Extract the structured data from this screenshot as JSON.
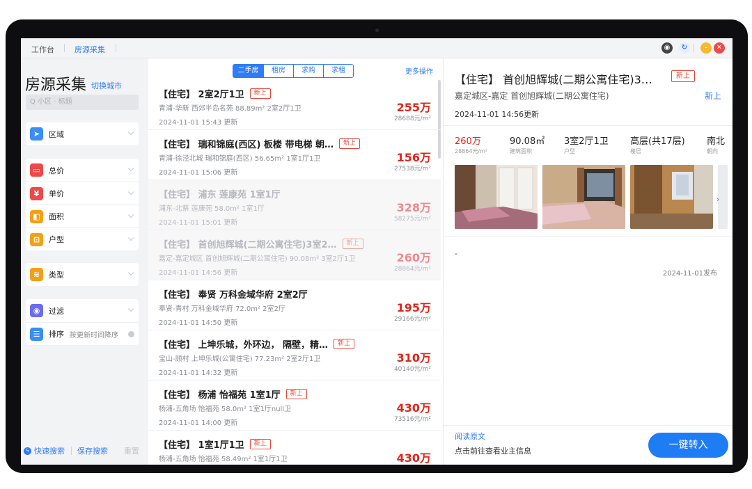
{
  "topbar": {
    "tabs": [
      {
        "label": "工作台"
      },
      {
        "label": "房源采集"
      }
    ],
    "icons": [
      "globe-icon",
      "refresh-icon",
      "minimize-icon",
      "close-icon"
    ]
  },
  "sidebar": {
    "title": "房源采集",
    "switch_city": "切换城市",
    "search_placeholder": "Q 小区 · 标题",
    "groups": [
      {
        "items": [
          {
            "label": "区域",
            "icon": "location-arrow-icon",
            "color": "#3a8ef6"
          }
        ]
      },
      {
        "items": [
          {
            "label": "总价",
            "icon": "wallet-icon",
            "color": "#f04848"
          },
          {
            "label": "单价",
            "icon": "yen-icon",
            "color": "#f04848"
          },
          {
            "label": "面积",
            "icon": "area-icon",
            "color": "#f5a014"
          },
          {
            "label": "户型",
            "icon": "floorplan-icon",
            "color": "#f5a014"
          }
        ]
      },
      {
        "items": [
          {
            "label": "类型",
            "icon": "layers-icon",
            "color": "#f5a014"
          }
        ]
      },
      {
        "items": [
          {
            "label": "过滤",
            "icon": "filter-icon",
            "color": "#6b6cf0"
          },
          {
            "label": "排序",
            "icon": "list-icon",
            "color": "#3a8ef6",
            "value": "按更新时间降序"
          }
        ]
      }
    ],
    "quick_search": "快速搜索",
    "save_search": "保存搜索",
    "reset": "重置"
  },
  "list": {
    "filter_tabs": [
      "二手房",
      "租房",
      "求购",
      "求租"
    ],
    "more_actions": "更多操作",
    "items": [
      {
        "title": "【住宅】 2室2厅1卫",
        "badge": "新上",
        "sub": "青浦-华新    西郊半岛名苑    88.89m²    2室2厅1卫",
        "time": "2024-11-01 15:43 更新",
        "price": "255万",
        "unit": "28688元/m²",
        "dim": false
      },
      {
        "title": "【住宅】 瑞和锦庭(西区) 板楼 带电梯 朝…",
        "badge": "新上",
        "sub": "青浦-徐泾北城    瑞和锦庭(西区)    56.65m²    1室1厅1卫",
        "time": "2024-11-01 15:06 更新",
        "price": "156万",
        "unit": "27538元/m²",
        "dim": false
      },
      {
        "title": "【住宅】 浦东 莲康苑 1室1厅",
        "badge": "",
        "sub": "浦东-北蔡    莲康苑    58.0m²    1室1厅",
        "time": "2024-11-01 15:01 更新",
        "price": "328万",
        "unit": "58275元/m²",
        "dim": true
      },
      {
        "title": "【住宅】 首创旭辉城(二期公寓住宅)3室2…",
        "badge": "新上",
        "sub": "嘉定-嘉定城区    首创旭辉城(二期公寓住宅)    90.08m²    3室2厅1卫",
        "time": "2024-11-01 14:56 更新",
        "price": "260万",
        "unit": "28864元/m²",
        "dim": true
      },
      {
        "title": "【住宅】 奉贤 万科金域华府 2室2厅",
        "badge": "",
        "sub": "奉贤-青村    万科金域华府    72.0m²    2室2厅",
        "time": "2024-11-01 14:50 更新",
        "price": "195万",
        "unit": "29166元/m²",
        "dim": false
      },
      {
        "title": "【住宅】 上坤乐城，外环边， 隔壁，精…",
        "badge": "新上",
        "sub": "宝山-顾村    上坤乐城(公寓住宅)    77.23m²    2室2厅1卫",
        "time": "2024-11-01 14:32 更新",
        "price": "310万",
        "unit": "40140元/m²",
        "dim": false
      },
      {
        "title": "【住宅】 杨浦 怡福苑 1室1厅",
        "badge": "新上",
        "sub": "杨浦-五角场    怡福苑    58.0m²    1室1厅null卫",
        "time": "2024-11-01 14:00 更新",
        "price": "430万",
        "unit": "73516元/m²",
        "dim": false
      },
      {
        "title": "【住宅】 1室1厅1卫",
        "badge": "新上",
        "sub": "杨浦-五角场    怡福苑    58.49m²    1室1厅1卫",
        "time": "",
        "price": "430万",
        "unit": "",
        "dim": false
      }
    ]
  },
  "detail": {
    "title": "【住宅】 首创旭辉城(二期公寓住宅)3…",
    "badge": "新上",
    "sub": "嘉定城区-嘉定    首创旭辉城(二期公寓住宅)",
    "new_tag": "新上",
    "updated": "2024-11-01 14:56更新",
    "specs": [
      {
        "value": "260万",
        "label": "28864元/m²",
        "red": true
      },
      {
        "value": "90.08㎡",
        "label": "建筑面积",
        "red": false
      },
      {
        "value": "3室2厅1卫",
        "label": "户型",
        "red": false
      },
      {
        "value": "高层(共17层)",
        "label": "楼层",
        "red": false
      },
      {
        "value": "南北",
        "label": "朝向",
        "red": false
      }
    ],
    "dash": "-",
    "published": "2024-11-01发布",
    "read_original": "阅读原文",
    "owner_info": "点击前往查看业主信息",
    "transfer_button": "一键转入"
  }
}
